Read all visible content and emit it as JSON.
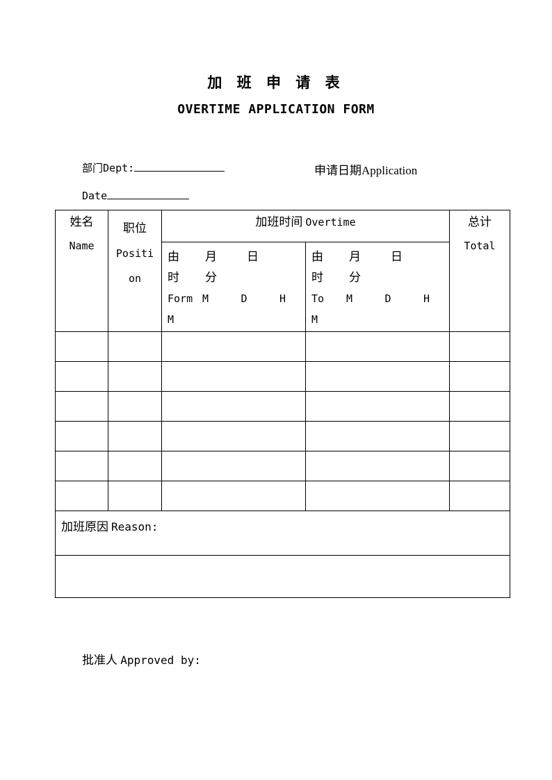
{
  "document": {
    "title_cn": "加 班 申 请 表",
    "title_en": "OVERTIME  APPLICATION FORM"
  },
  "header_fields": {
    "dept_label": "部门Dept:",
    "dept_value": "",
    "application_date_label": "申请日期Application",
    "date_label": "Date",
    "date_value": ""
  },
  "table": {
    "overtime_group_cn": "加班时间",
    "overtime_group_en": "Overtime",
    "columns": {
      "name_cn": "姓名",
      "name_en": "Name",
      "position_cn": "职位",
      "position_en_part1": "Positi",
      "position_en_part2": "on",
      "total_cn": "总计",
      "total_en": "Total"
    },
    "from_block": {
      "cn_line1_a": "由",
      "cn_line1_b": "月",
      "cn_line1_c": "日",
      "cn_line2_a": "时",
      "cn_line2_b": "分",
      "en_line1_a": "Form",
      "en_line1_b": "M",
      "en_line1_c": "D",
      "en_line1_d": "H",
      "en_line2_a": "M"
    },
    "to_block": {
      "cn_line1_a": "由",
      "cn_line1_b": "月",
      "cn_line1_c": "日",
      "cn_line2_a": "时",
      "cn_line2_b": "分",
      "en_line1_a": "To",
      "en_line1_b": "M",
      "en_line1_c": "D",
      "en_line1_d": "H",
      "en_line2_a": "M"
    },
    "data_rows": [
      {
        "name": "",
        "position": "",
        "from": "",
        "to": "",
        "total": ""
      },
      {
        "name": "",
        "position": "",
        "from": "",
        "to": "",
        "total": ""
      },
      {
        "name": "",
        "position": "",
        "from": "",
        "to": "",
        "total": ""
      },
      {
        "name": "",
        "position": "",
        "from": "",
        "to": "",
        "total": ""
      },
      {
        "name": "",
        "position": "",
        "from": "",
        "to": "",
        "total": ""
      },
      {
        "name": "",
        "position": "",
        "from": "",
        "to": "",
        "total": ""
      }
    ],
    "reason_cn": "加班原因",
    "reason_en": "Reason:",
    "reason_value": "",
    "notes_value": ""
  },
  "footer": {
    "approved_cn": "批准人",
    "approved_en": "Approved by:",
    "approved_value": ""
  },
  "colors": {
    "text": "#000000",
    "border": "#000000",
    "background": "#ffffff"
  }
}
